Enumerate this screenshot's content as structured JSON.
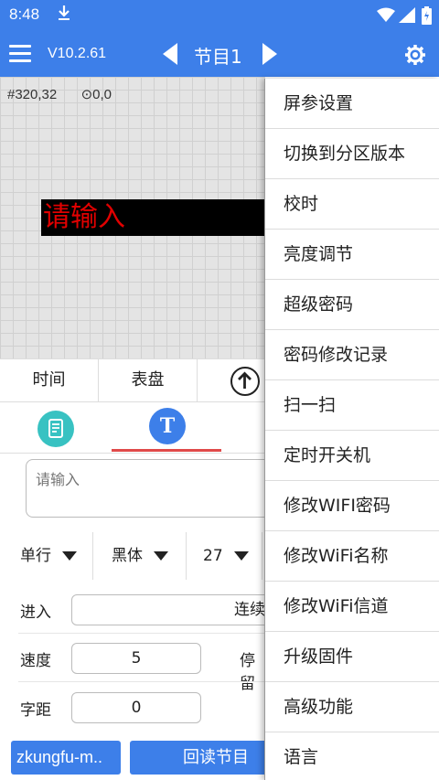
{
  "status": {
    "time": "8:48"
  },
  "toolbar": {
    "version": "V10.2.61",
    "title": "节目1"
  },
  "canvas": {
    "size_readout": "320,32",
    "pos_readout": "0,0",
    "led_text": "请输入"
  },
  "tabs": {
    "time": "时间",
    "dial": "表盘"
  },
  "text_input": {
    "placeholder": "请输入"
  },
  "options": {
    "line_mode": "单行",
    "font": "黑体",
    "size": "27"
  },
  "fields": {
    "enter_label": "进入",
    "enter_value": "连续左",
    "speed_label": "速度",
    "speed_value": "5",
    "stay_label": "停留",
    "spacing_label": "字距",
    "spacing_value": "0"
  },
  "buttons": {
    "device": "zkungfu-m..",
    "readback": "回读节目"
  },
  "menu": [
    {
      "label": "屏参设置"
    },
    {
      "label": "切换到分区版本"
    },
    {
      "label": "校时"
    },
    {
      "label": "亮度调节"
    },
    {
      "label": "超级密码"
    },
    {
      "label": "密码修改记录"
    },
    {
      "label": "扫一扫"
    },
    {
      "label": "定时开关机"
    },
    {
      "label": "修改WIFI密码"
    },
    {
      "label": "修改WiFi名称"
    },
    {
      "label": "修改WiFi信道"
    },
    {
      "label": "升级固件"
    },
    {
      "label": "高级功能"
    },
    {
      "label": "语言"
    }
  ],
  "colors": {
    "primary": "#3d7fe9",
    "led_text": "#e00000",
    "accent_underline": "#e04a4a"
  }
}
